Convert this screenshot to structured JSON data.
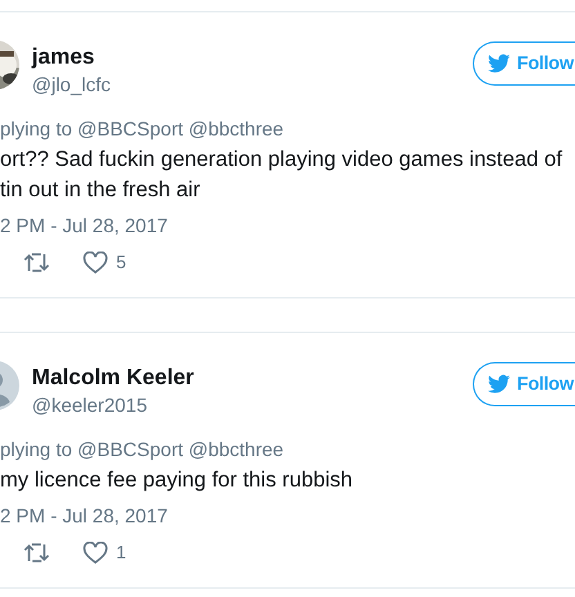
{
  "tweets": [
    {
      "name": "james",
      "handle": "@jlo_lcfc",
      "follow_label": "Follow",
      "replying": "plying to @BBCSport @bbcthree",
      "text_lines": [
        "ort?? Sad fuckin generation playing video games instead of",
        "tin out in the fresh air"
      ],
      "timestamp": "2 PM - Jul 28, 2017",
      "likes": "5"
    },
    {
      "name": "Malcolm Keeler",
      "handle": "@keeler2015",
      "avatar": {
        "kind": "default"
      },
      "follow_label": "Follow",
      "replying": "plying to @BBCSport @bbcthree",
      "text_lines": [
        "my licence fee paying for this rubbish"
      ],
      "timestamp": "2 PM - Jul 28, 2017",
      "likes": "1"
    }
  ]
}
